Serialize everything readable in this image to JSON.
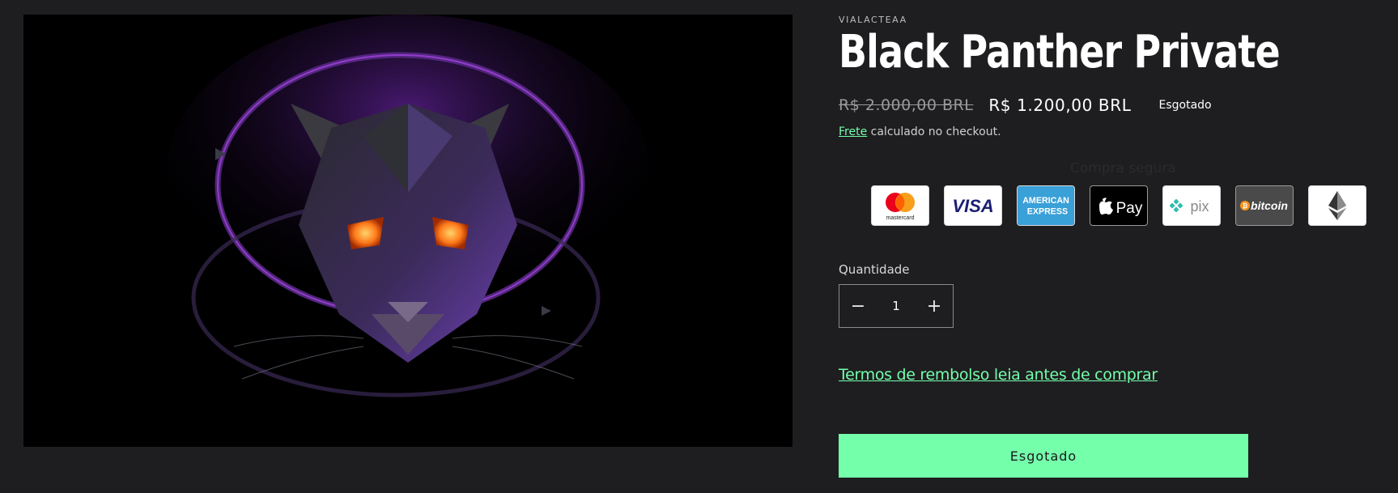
{
  "product": {
    "vendor": "VIALACTEAA",
    "title": "Black Panther Private",
    "price_old": "R$ 2.000,00 BRL",
    "price_new": "R$ 1.200,00 BRL",
    "badge": "Esgotado",
    "shipping_link": "Frete",
    "shipping_text": " calculado no checkout.",
    "secure_label": "Compra segura"
  },
  "payments": [
    {
      "name": "mastercard",
      "label": "mastercard"
    },
    {
      "name": "visa",
      "label": "VISA"
    },
    {
      "name": "amex",
      "label": "AMERICAN EXPRESS"
    },
    {
      "name": "apple-pay",
      "label": "Pay"
    },
    {
      "name": "pix",
      "label": "pix"
    },
    {
      "name": "bitcoin",
      "label": "bitcoin"
    },
    {
      "name": "ethereum",
      "label": ""
    }
  ],
  "quantity": {
    "label": "Quantidade",
    "value": "1",
    "minus": "−",
    "plus": "+"
  },
  "terms_link": "Termos de rembolso leia antes de comprar",
  "buy_button": "Esgotado",
  "colors": {
    "background": "#1e1e20",
    "accent": "#74ffab",
    "text": "#ffffff"
  }
}
